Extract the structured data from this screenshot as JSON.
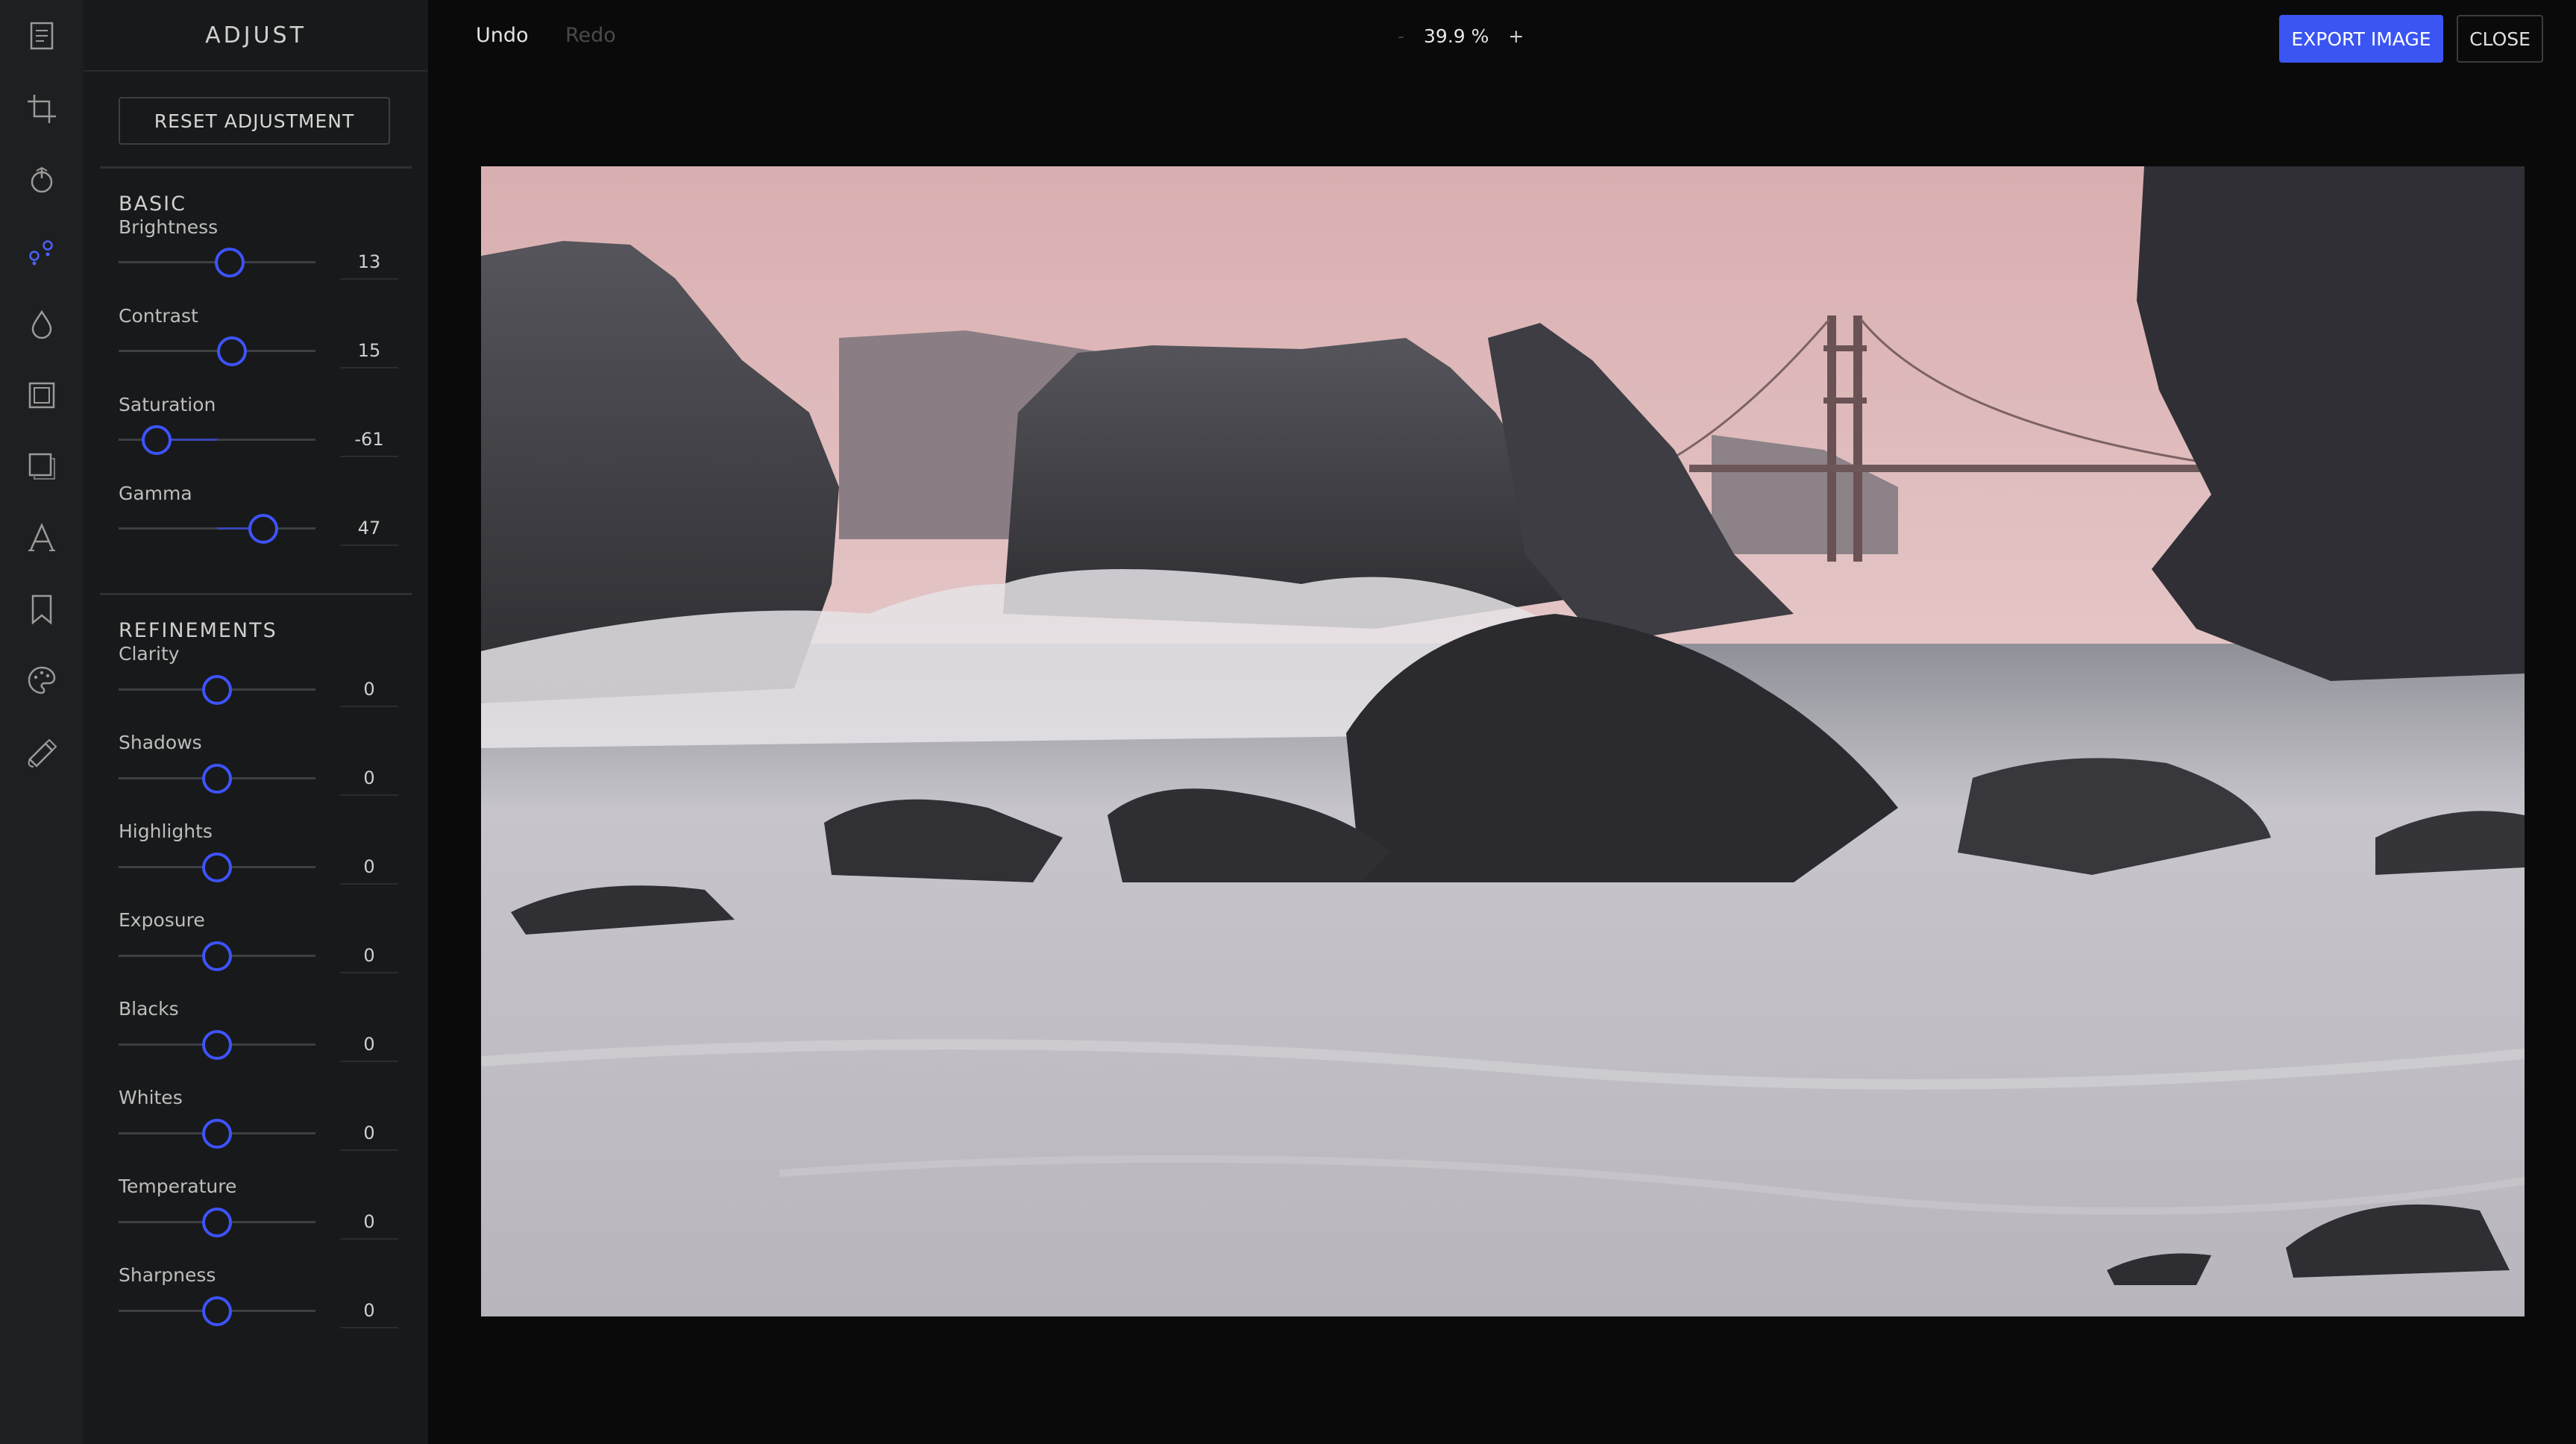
{
  "panel": {
    "title": "ADJUST",
    "reset_label": "RESET ADJUSTMENT",
    "sections": [
      {
        "heading": "BASIC",
        "controls": [
          {
            "label": "Brightness",
            "value": 13
          },
          {
            "label": "Contrast",
            "value": 15
          },
          {
            "label": "Saturation",
            "value": -61
          },
          {
            "label": "Gamma",
            "value": 47
          }
        ]
      },
      {
        "heading": "REFINEMENTS",
        "controls": [
          {
            "label": "Clarity",
            "value": 0
          },
          {
            "label": "Shadows",
            "value": 0
          },
          {
            "label": "Highlights",
            "value": 0
          },
          {
            "label": "Exposure",
            "value": 0
          },
          {
            "label": "Blacks",
            "value": 0
          },
          {
            "label": "Whites",
            "value": 0
          },
          {
            "label": "Temperature",
            "value": 0
          },
          {
            "label": "Sharpness",
            "value": 0
          }
        ]
      }
    ]
  },
  "rail": {
    "tools": [
      "file-icon",
      "crop-icon",
      "filter-icon",
      "adjust-icon",
      "drop-icon",
      "frame-icon",
      "overlay-icon",
      "text-icon",
      "bookmark-icon",
      "palette-icon",
      "brush-icon"
    ],
    "active": "adjust-icon"
  },
  "topbar": {
    "undo_label": "Undo",
    "redo_label": "Redo",
    "zoom_out": "-",
    "zoom_level": "39.9 %",
    "zoom_in": "+",
    "export_label": "EXPORT IMAGE",
    "close_label": "CLOSE"
  },
  "colors": {
    "accent": "#3b55f2",
    "slider_knob": "#3d53ff",
    "panel_bg": "#18191a",
    "rail_bg": "#1e1f21",
    "app_bg": "#0a0a0a"
  }
}
